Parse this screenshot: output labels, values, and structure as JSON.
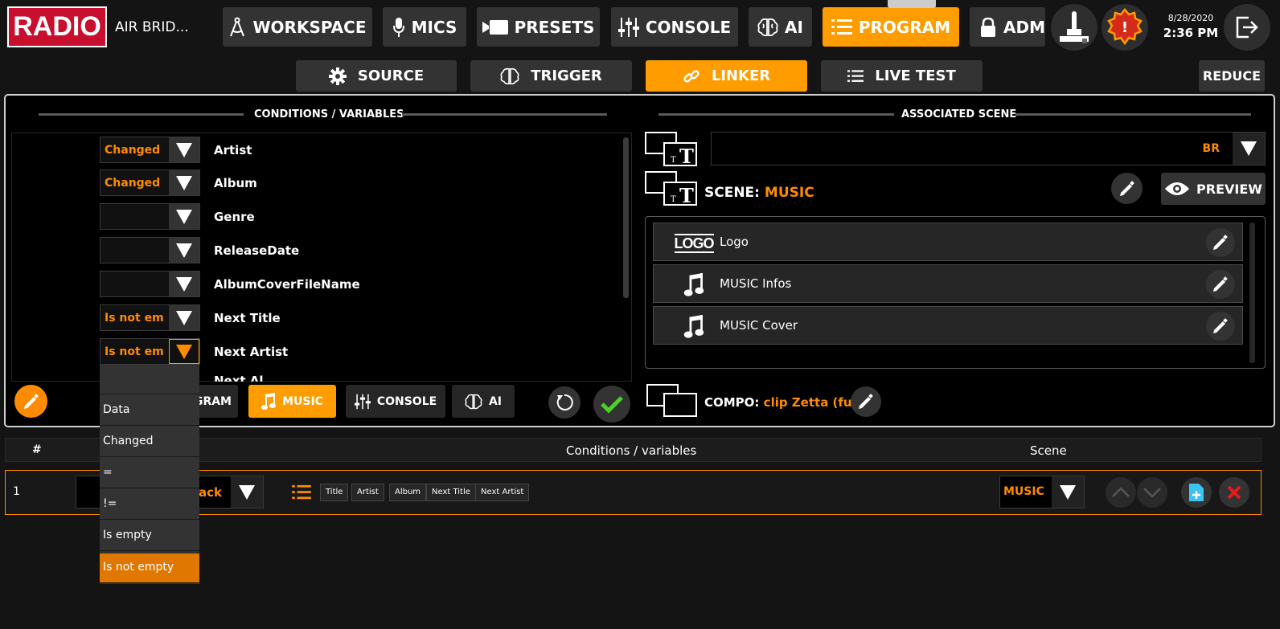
{
  "app": {
    "logo": "RADIO",
    "station": "AIR BRID..."
  },
  "nav": [
    {
      "label": "WORKSPACE",
      "icon": "compass-icon"
    },
    {
      "label": "MICS",
      "icon": "microphone-icon"
    },
    {
      "label": "PRESETS",
      "icon": "camera-icon"
    },
    {
      "label": "CONSOLE",
      "icon": "sliders-icon"
    },
    {
      "label": "AI",
      "icon": "brain-icon"
    },
    {
      "label": "PROGRAM",
      "icon": "list-icon"
    },
    {
      "label": "ADM",
      "icon": "lock-icon"
    }
  ],
  "clock": {
    "date": "8/28/2020",
    "time": "2:36 PM"
  },
  "tabs": [
    {
      "label": "SOURCE",
      "icon": "gear-icon"
    },
    {
      "label": "TRIGGER",
      "icon": "brain-icon"
    },
    {
      "label": "LINKER",
      "icon": "link-icon"
    },
    {
      "label": "LIVE TEST",
      "icon": "list-icon"
    }
  ],
  "reduce_label": "REDUCE",
  "left_panel": {
    "header": "CONDITIONS / VARIABLES",
    "conditions": [
      {
        "op": "Changed",
        "label": "Artist"
      },
      {
        "op": "Changed",
        "label": "Album"
      },
      {
        "op": "",
        "label": "Genre"
      },
      {
        "op": "",
        "label": "ReleaseDate"
      },
      {
        "op": "",
        "label": "AlbumCoverFileName"
      },
      {
        "op": "Is not em",
        "label": "Next Title"
      },
      {
        "op": "Is not em",
        "label": "Next Artist"
      },
      {
        "op": "",
        "label": "Next Al"
      }
    ],
    "dropdown_options": [
      "",
      "Data",
      "Changed",
      "=",
      "!=",
      "Is empty",
      "Is not empty"
    ],
    "dropdown_selected": "Is not empty",
    "sources": [
      {
        "label": "GRAM",
        "icon": "list-icon"
      },
      {
        "label": "MUSIC",
        "icon": "music-note-icon"
      },
      {
        "label": "CONSOLE",
        "icon": "sliders-icon"
      },
      {
        "label": "AI",
        "icon": "brain-icon"
      }
    ]
  },
  "right_panel": {
    "header": "ASSOCIATED SCENE",
    "scene_select": "BR",
    "scene_prefix": "SCENE:",
    "scene_name": "MUSIC",
    "preview_label": "PREVIEW",
    "logo_text": "LOGO",
    "items": [
      {
        "name": "Logo",
        "icon": "logo-icon"
      },
      {
        "name": "MUSIC Infos",
        "icon": "music-note-icon"
      },
      {
        "name": "MUSIC Cover",
        "icon": "music-note-icon"
      }
    ],
    "compo_prefix": "COMPO:",
    "compo_name": "clip Zetta (full)"
  },
  "table": {
    "columns": [
      "#",
      "Conditions / variables",
      "Scene"
    ],
    "rows": [
      {
        "index": "1",
        "source_suffix": "ack",
        "chips": [
          "Title",
          "Artist",
          "Album",
          "Next Title",
          "Next Artist"
        ],
        "scene": "MUSIC"
      }
    ]
  },
  "colors": {
    "accent": "#ff9d00",
    "background": "#141414",
    "panel": "#333333",
    "highlight_text": "#ff8c00"
  }
}
